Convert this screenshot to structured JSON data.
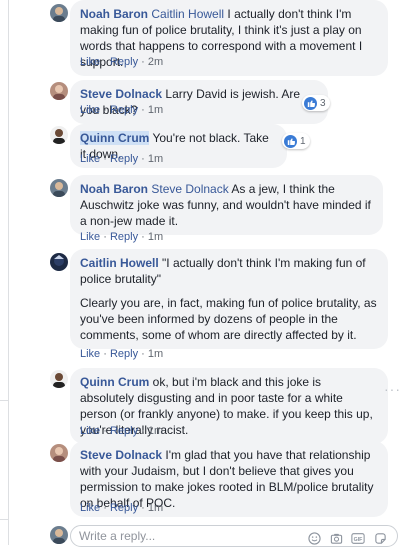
{
  "comments": [
    {
      "author": "Noah Baron",
      "mention": "Caitlin Howell",
      "text": "I actually don't think I'm making fun of police brutality, I think it's just a play on words that happens to correspond with a movement I support.",
      "like_label": "Like",
      "reply_label": "Reply",
      "time": "2m"
    },
    {
      "author": "Steve Dolnack",
      "text": "Larry David is jewish. Are you black?",
      "like_label": "Like",
      "reply_label": "Reply",
      "time": "1m",
      "reactions": "3"
    },
    {
      "author": "Quinn Crum",
      "text": "You're not black. Take it down.",
      "like_label": "Like",
      "reply_label": "Reply",
      "time": "1m",
      "reactions": "1"
    },
    {
      "author": "Noah Baron",
      "mention": "Steve Dolnack",
      "text": "As a jew, I think the Auschwitz joke was funny, and wouldn't have minded if a non-jew made it.",
      "like_label": "Like",
      "reply_label": "Reply",
      "time": "1m"
    },
    {
      "author": "Caitlin Howell",
      "text": "\"I actually don't think I'm making fun of police brutality\"",
      "text2": "Clearly you are, in fact, making fun of police brutality, as you've been informed by dozens of people in the comments, some of whom are directly affected by it.",
      "like_label": "Like",
      "reply_label": "Reply",
      "time": "1m"
    },
    {
      "author": "Quinn Crum",
      "text": "ok, but i'm black and this joke is absolutely disgusting and in poor taste for a white person (or frankly anyone) to make. if you keep this up, you're literally racist.",
      "like_label": "Like",
      "reply_label": "Reply",
      "time": "1m"
    },
    {
      "author": "Steve Dolnack",
      "text": "I'm glad that you have that relationship with your Judaism, but I don't believe that gives you permission to make jokes rooted in BLM/police brutality on behalf of POC.",
      "like_label": "Like",
      "reply_label": "Reply",
      "time": "1m"
    }
  ],
  "reply_box": {
    "placeholder": "Write a reply..."
  },
  "icons": {
    "emoji": "smile-icon",
    "camera": "camera-icon",
    "gif": "gif-icon",
    "sticker": "sticker-icon",
    "gif_text": "GIF"
  },
  "colors": {
    "link": "#385898",
    "bubble": "#f2f3f5",
    "like_blue": "#3a7bd5",
    "meta": "#616770"
  }
}
